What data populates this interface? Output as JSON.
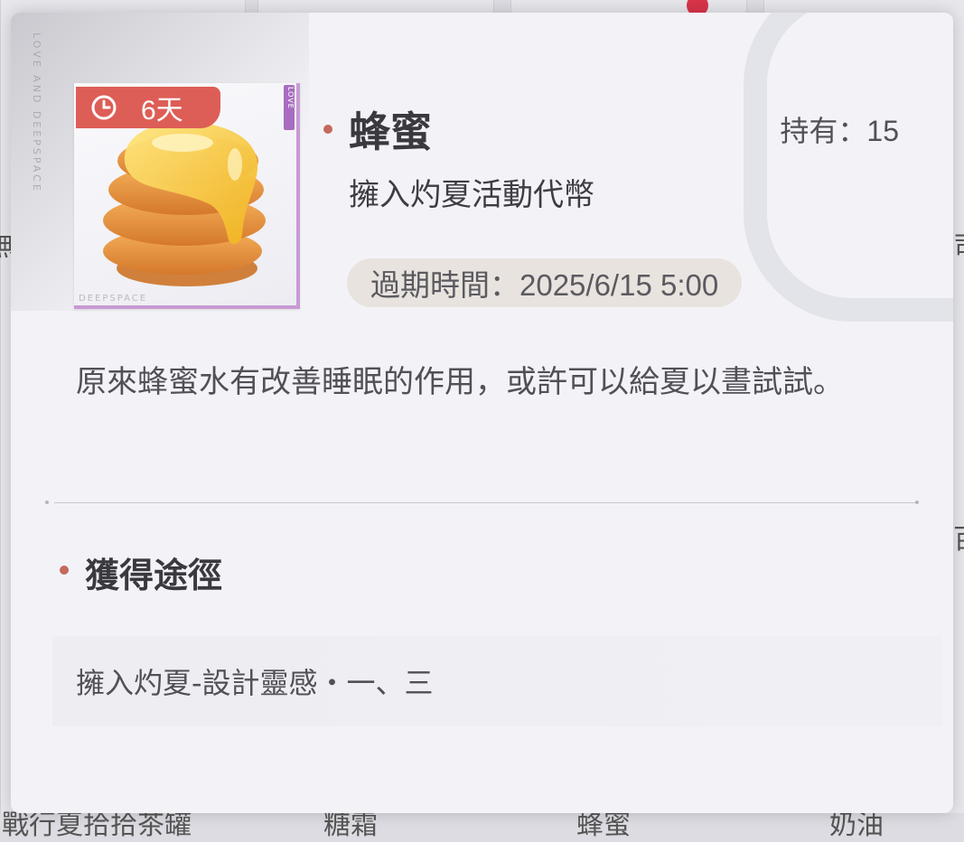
{
  "item": {
    "name": "蜂蜜",
    "owned": "持有：15",
    "category": "擁入灼夏活動代幣",
    "expiry": "過期時間：2025/6/15 5:00",
    "timer_badge": "6天",
    "description": "原來蜂蜜水有改善睡眠的作用，或許可以給夏以晝試試。",
    "thumb_brand": "DEEPSPACE",
    "thumb_tag": "LOVE",
    "side_brand": "LOVE AND DEEPSPACE",
    "accent_color": "#dd5e56",
    "frame_color": "#c89ad4"
  },
  "sources": {
    "title": "獲得途徑",
    "items": [
      "擁入灼夏-設計靈感・一、三"
    ]
  },
  "background": {
    "left_edge_1": "無",
    "right_edge_1": "司",
    "right_edge_2": "百",
    "bottom_labels": [
      "戰行夏拾拾茶罐",
      "糖霜",
      "蜂蜜",
      "奶油"
    ]
  },
  "icons": {
    "timer": "clock-icon",
    "item": "honey-stack-icon"
  }
}
